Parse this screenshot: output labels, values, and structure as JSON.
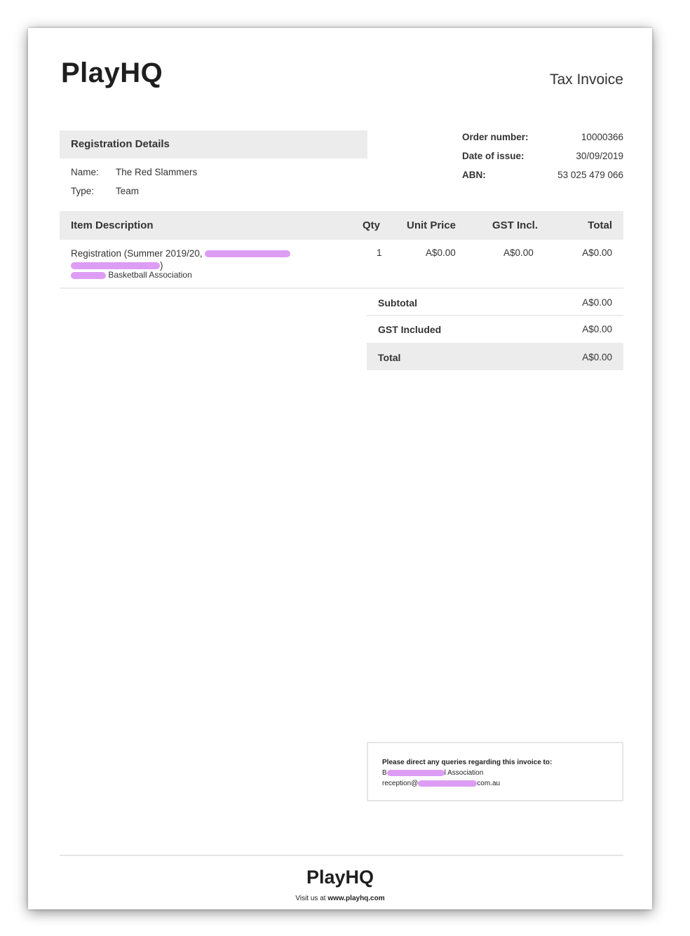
{
  "header": {
    "logo": "PlayHQ",
    "document_type": "Tax Invoice"
  },
  "registration": {
    "heading": "Registration Details",
    "name_label": "Name:",
    "name_value": "The Red Slammers",
    "type_label": "Type:",
    "type_value": "Team"
  },
  "order": {
    "order_number_label": "Order number:",
    "order_number_value": "10000366",
    "date_label": "Date of issue:",
    "date_value": "30/09/2019",
    "abn_label": "ABN:",
    "abn_value": "53 025 479 066"
  },
  "table": {
    "headers": {
      "description": "Item Description",
      "qty": "Qty",
      "unit_price": "Unit Price",
      "gst": "GST Incl.",
      "total": "Total"
    },
    "items": [
      {
        "description_prefix": "Registration (Summer 2019/20, ",
        "description_suffix": ")",
        "org_suffix": " Basketball Association",
        "qty": "1",
        "unit_price": "A$0.00",
        "gst": "A$0.00",
        "total": "A$0.00"
      }
    ]
  },
  "summary": {
    "subtotal_label": "Subtotal",
    "subtotal_value": "A$0.00",
    "gst_label": "GST Included",
    "gst_value": "A$0.00",
    "total_label": "Total",
    "total_value": "A$0.00"
  },
  "queries": {
    "title": "Please direct any queries regarding this invoice to:",
    "org_prefix": "B",
    "org_suffix": "l Association",
    "email_prefix": "reception@",
    "email_suffix": "com.au"
  },
  "footer": {
    "logo": "PlayHQ",
    "visit_prefix": "Visit us at ",
    "visit_link": "www.playhq.com"
  },
  "colors": {
    "header_bar": "#ececec",
    "redaction": "#d78cf2"
  }
}
